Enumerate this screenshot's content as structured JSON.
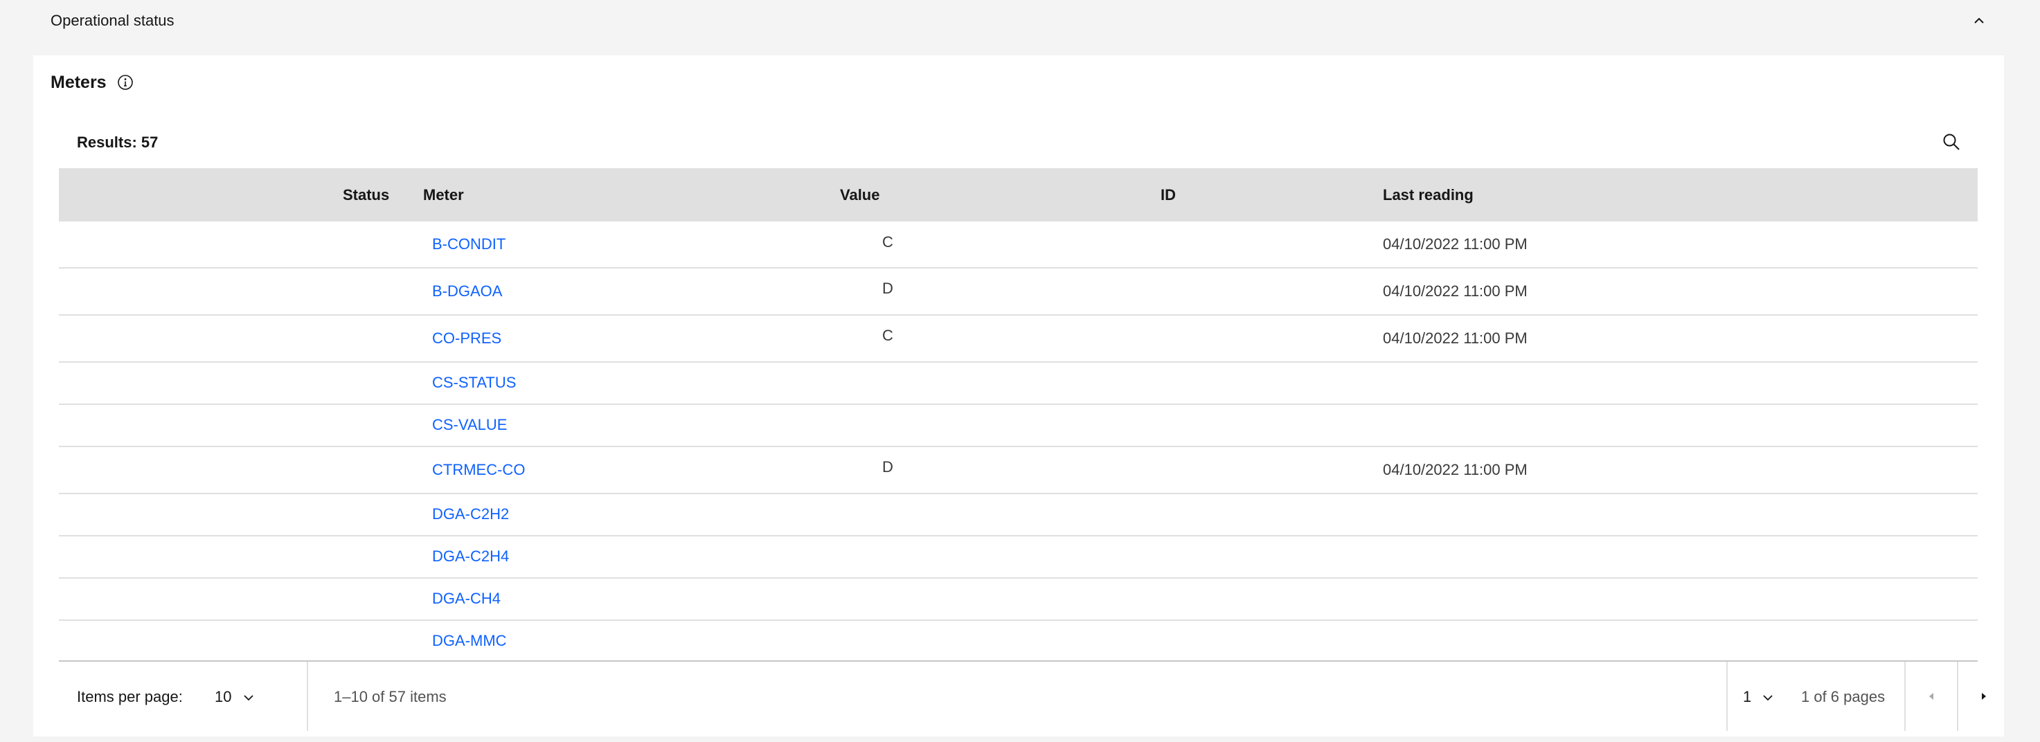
{
  "accordion": {
    "title": "Operational status",
    "expanded": true
  },
  "card": {
    "title": "Meters"
  },
  "toolbar": {
    "results": "Results: 57"
  },
  "table": {
    "columns": [
      "Status",
      "Meter",
      "Value",
      "ID",
      "Last reading"
    ],
    "rows": [
      {
        "status": "",
        "meter": "B-CONDIT",
        "value": "C",
        "id": "",
        "last_reading": "04/10/2022 11:00 PM"
      },
      {
        "status": "",
        "meter": "B-DGAOA",
        "value": "D",
        "id": "",
        "last_reading": "04/10/2022 11:00 PM"
      },
      {
        "status": "",
        "meter": "CO-PRES",
        "value": "C",
        "id": "",
        "last_reading": "04/10/2022 11:00 PM"
      },
      {
        "status": "",
        "meter": "CS-STATUS",
        "value": "",
        "id": "",
        "last_reading": ""
      },
      {
        "status": "",
        "meter": "CS-VALUE",
        "value": "",
        "id": "",
        "last_reading": ""
      },
      {
        "status": "",
        "meter": "CTRMEC-CO",
        "value": "D",
        "id": "",
        "last_reading": "04/10/2022 11:00 PM"
      },
      {
        "status": "",
        "meter": "DGA-C2H2",
        "value": "",
        "id": "",
        "last_reading": ""
      },
      {
        "status": "",
        "meter": "DGA-C2H4",
        "value": "",
        "id": "",
        "last_reading": ""
      },
      {
        "status": "",
        "meter": "DGA-CH4",
        "value": "",
        "id": "",
        "last_reading": ""
      },
      {
        "status": "",
        "meter": "DGA-MMC",
        "value": "",
        "id": "",
        "last_reading": ""
      }
    ]
  },
  "pagination": {
    "items_per_page_label": "Items per page:",
    "items_per_page_value": "10",
    "range_text": "1–10 of 57 items",
    "page_value": "1",
    "pages_text": "1 of 6 pages"
  },
  "colors": {
    "link": "#0f62fe",
    "header_bg": "#e0e0e0",
    "page_bg": "#f4f4f4"
  },
  "icons": {
    "collapse": "chevron-up-icon",
    "info": "info-icon",
    "search": "search-icon",
    "prev": "caret-left-icon",
    "next": "caret-right-icon"
  }
}
